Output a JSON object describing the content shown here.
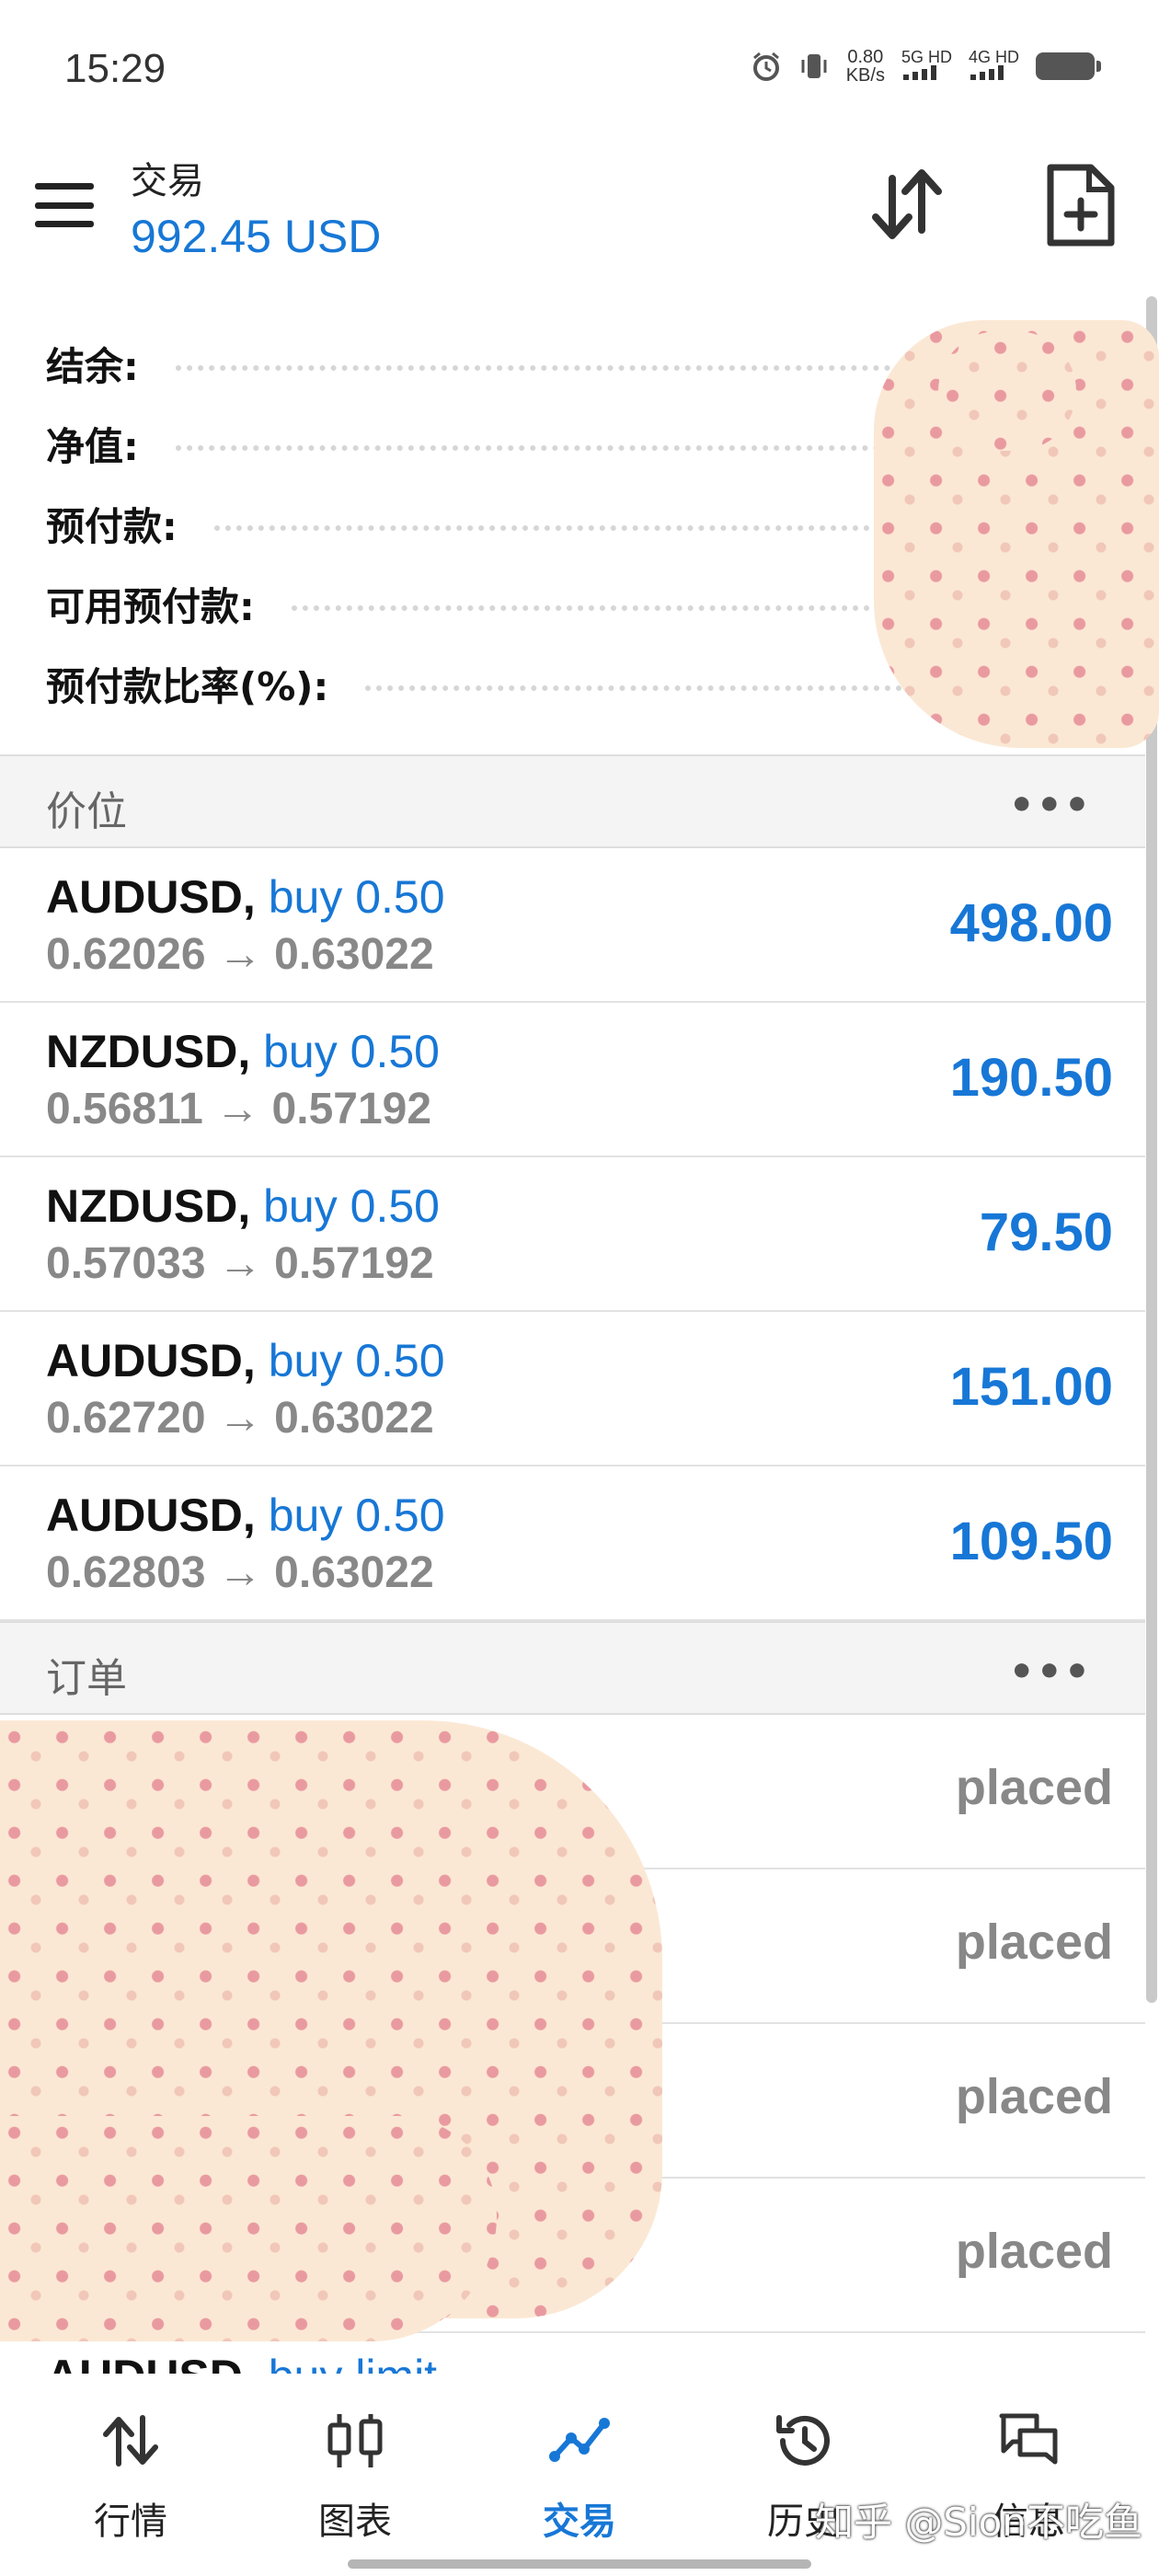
{
  "status_bar": {
    "time": "15:29",
    "net_speed_value": "0.80",
    "net_speed_unit": "KB/s",
    "sim1": "5G HD",
    "sim2": "4G HD"
  },
  "header": {
    "title": "交易",
    "balance": "992.45 USD"
  },
  "summary": [
    {
      "label": "结余:"
    },
    {
      "label": "净值:"
    },
    {
      "label": "预付款:"
    },
    {
      "label": "可用预付款:"
    },
    {
      "label": "预付款比率(%):"
    }
  ],
  "positions_section": {
    "title": "价位",
    "more": "•••"
  },
  "positions": [
    {
      "symbol": "AUDUSD,",
      "type": "buy 0.50",
      "prices": "0.62026 → 0.63022",
      "profit": "498.00"
    },
    {
      "symbol": "NZDUSD,",
      "type": "buy 0.50",
      "prices": "0.56811 → 0.57192",
      "profit": "190.50"
    },
    {
      "symbol": "NZDUSD,",
      "type": "buy 0.50",
      "prices": "0.57033 → 0.57192",
      "profit": "79.50"
    },
    {
      "symbol": "AUDUSD,",
      "type": "buy 0.50",
      "prices": "0.62720 → 0.63022",
      "profit": "151.00"
    },
    {
      "symbol": "AUDUSD,",
      "type": "buy 0.50",
      "prices": "0.62803 → 0.63022",
      "profit": "109.50"
    }
  ],
  "orders_section": {
    "title": "订单",
    "more": "•••"
  },
  "orders": [
    {
      "status": "placed"
    },
    {
      "status": "placed"
    },
    {
      "status": "placed"
    },
    {
      "status": "placed"
    }
  ],
  "partial_order": {
    "symbol": "AUDUSD,",
    "type": "buy limit"
  },
  "bottom_nav": [
    {
      "label": "行情",
      "icon": "quotes-arrows-icon"
    },
    {
      "label": "图表",
      "icon": "candlestick-chart-icon"
    },
    {
      "label": "交易",
      "icon": "trade-line-icon",
      "active": true
    },
    {
      "label": "历史",
      "icon": "history-clock-icon"
    },
    {
      "label": "信息",
      "icon": "chat-bubbles-icon"
    }
  ],
  "watermark": "知乎 @Sion不吃鱼",
  "colors": {
    "accent": "#1777d6",
    "muted": "#888888",
    "section_bg": "#f4f4f4"
  }
}
